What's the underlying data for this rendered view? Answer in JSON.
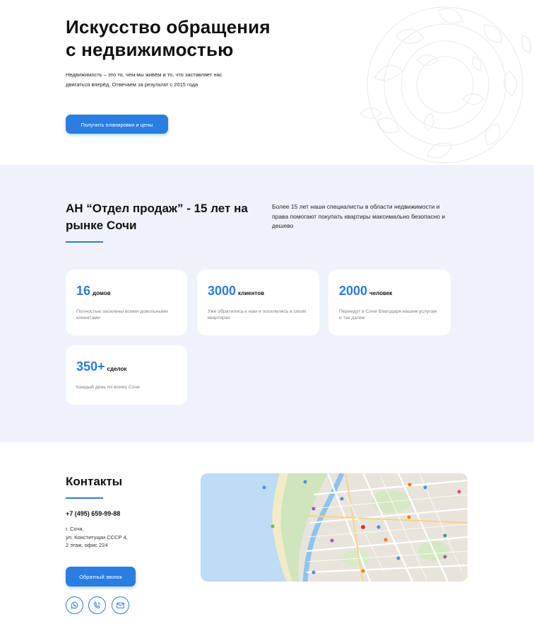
{
  "hero": {
    "title_line1": "Искусство обращения",
    "title_line2": "с недвижимостью",
    "text": "Недвижимость – это то, чем мы живём и то, что заставляет нас двигаться вперёд. Отвечаем за результат с 2015 года",
    "button_label": "Получить планировки и цены"
  },
  "about": {
    "title_line1": "АН “Отдел продаж” - 15 лет на",
    "title_line2": "рынке Сочи",
    "description": "Более 15 лет наши специалисты в области недвижимости и права помогают покупать квартиры максимально безопасно и дешево",
    "stats": [
      {
        "number": "16",
        "unit": "домов",
        "desc": "Полностью заселены всеми довольными клиентами"
      },
      {
        "number": "3000",
        "unit": "клиентов",
        "desc": "Уже обратились к нам и поселились в своих квартирах"
      },
      {
        "number": "2000",
        "unit": "человек",
        "desc": "Переедут в Сочи благодаря нашим услугам и так далее"
      },
      {
        "number": "350+",
        "unit": "сделок",
        "desc": "Каждый день по всему Сочи"
      }
    ]
  },
  "contacts": {
    "title": "Контакты",
    "phone": "+7 (495) 659-99-88",
    "address_line1": "г. Сочи,",
    "address_line2": "ул. Конституции СССР 4,",
    "address_line3": "2 этаж, офис 224",
    "callback_label": "Обратный звонок",
    "social_icons": [
      "whatsapp-icon",
      "viber-icon",
      "email-icon"
    ]
  },
  "colors": {
    "accent": "#2a7de1",
    "section_bg": "#eef3fb",
    "muted_text": "#7a7f86"
  }
}
